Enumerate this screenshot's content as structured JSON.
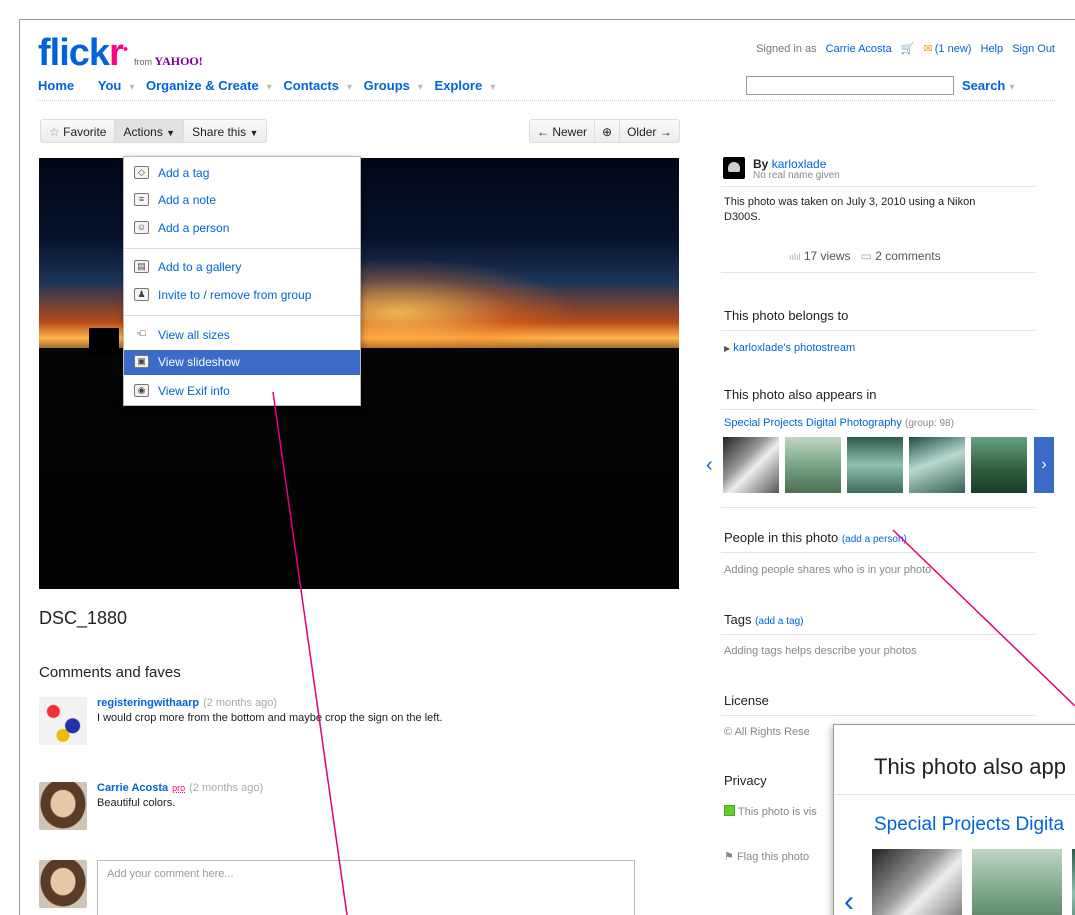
{
  "header": {
    "logo": "flickr",
    "logo_sub": "from",
    "logo_yahoo": "YAHOO!",
    "signed_in_prefix": "Signed in as",
    "user": "Carrie Acosta",
    "mail": "(1 new)",
    "help": "Help",
    "sign_out": "Sign Out",
    "nav": [
      "Home",
      "You",
      "Organize & Create",
      "Contacts",
      "Groups",
      "Explore"
    ],
    "search_label": "Search"
  },
  "toolbar": {
    "favorite": "Favorite",
    "actions": "Actions",
    "share": "Share this",
    "newer": "← Newer",
    "older": "Older →"
  },
  "actions_menu": {
    "items": [
      {
        "label": "Add a tag",
        "icon": "tag-add-icon"
      },
      {
        "label": "Add a note",
        "icon": "note-add-icon"
      },
      {
        "label": "Add a person",
        "icon": "person-add-icon"
      },
      {
        "label": "Add to a gallery",
        "icon": "gallery-add-icon"
      },
      {
        "label": "Invite to / remove from group",
        "icon": "group-icon"
      },
      {
        "label": "View all sizes",
        "icon": "sizes-icon"
      },
      {
        "label": "View slideshow",
        "icon": "slideshow-icon"
      },
      {
        "label": "View Exif info",
        "icon": "camera-icon"
      }
    ],
    "selected": "View slideshow"
  },
  "photo": {
    "title": "DSC_1880"
  },
  "comments": {
    "heading": "Comments and faves",
    "list": [
      {
        "user": "registeringwithaarp",
        "ago": "(2 months ago)",
        "text": "I would crop more from the bottom and maybe crop the sign on the left.",
        "pro": ""
      },
      {
        "user": "Carrie Acosta",
        "ago": "(2 months ago)",
        "text": "Beautiful colors.",
        "pro": "pro"
      }
    ],
    "placeholder": "Add your comment here..."
  },
  "sidebar": {
    "by": "By",
    "owner": "karloxlade",
    "owner_sub": "No real name given",
    "taken_line1": "This photo was taken on July 3, 2010 using a Nikon",
    "taken_line2": "D300S.",
    "views": "17 views",
    "comments": "2 comments",
    "belongs_heading": "This photo belongs to",
    "photostream": "karloxlade's photostream",
    "appears_heading": "This photo also appears in",
    "group_name": "Special Projects Digital Photography",
    "group_count": "(group: 98)",
    "people_heading": "People in this photo",
    "add_person": "(add a person)",
    "people_text": "Adding people shares who is in your photo",
    "tags_heading": "Tags",
    "add_tag": "(add a tag)",
    "tags_text": "Adding tags helps describe your photos",
    "license_heading": "License",
    "license_text": "All Rights Rese",
    "privacy_heading": "Privacy",
    "privacy_text": "This photo is vis",
    "flag": "Flag this photo"
  },
  "zoom": {
    "heading": "This photo also app",
    "group": "Special Projects Digita"
  },
  "colors": {
    "link": "#0063dc",
    "brand_pink": "#ff0084",
    "menu_selected": "#3a6cc7",
    "callout_line": "#e4007c"
  }
}
